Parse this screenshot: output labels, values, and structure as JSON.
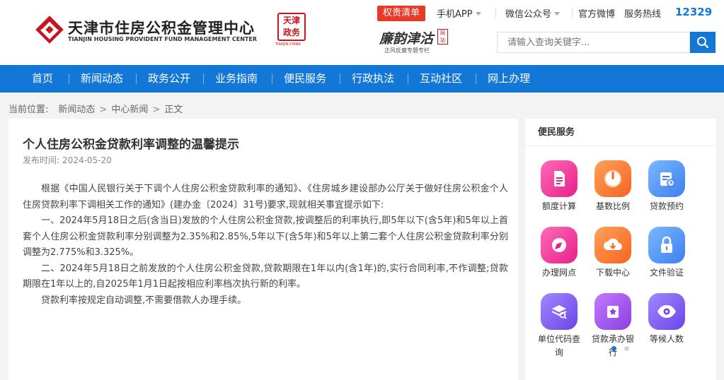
{
  "header": {
    "logo_icon": "housing-fund-logo-icon",
    "title_cn": "天津市住房公积金管理中心",
    "title_en": "TIANJIN HOUSING PROVIDENT FUND MANAGEMENT CENTER",
    "seal_text": [
      "天",
      "津",
      "政",
      "务"
    ],
    "seal_caption": "TIANJIN.CHINA",
    "power_list_badge": "权责清单",
    "brand_main": "廉韵津沽",
    "brand_tag": "网站",
    "brand_sub": "正风反腐专题专栏",
    "top_links": [
      {
        "label": "手机APP",
        "dropdown": true
      },
      {
        "label": "微信公众号",
        "dropdown": true
      },
      {
        "label": "官方微博",
        "dropdown": false
      },
      {
        "label": "服务热线",
        "dropdown": false
      }
    ],
    "hotline_number": "12329",
    "search_placeholder": "请输入查询关键字...",
    "search_icon": "search-icon",
    "accent_color": "#1377d8",
    "badge_color": "#e83828"
  },
  "nav": {
    "items": [
      "首页",
      "新闻动态",
      "政务公开",
      "业务指南",
      "便民服务",
      "行政执法",
      "互动社区",
      "网上办理"
    ]
  },
  "breadcrumb": {
    "label": "当前位置:",
    "items": [
      "新闻动态",
      "中心新闻",
      "正文"
    ],
    "separator": ">"
  },
  "article": {
    "title": "个人住房公积金贷款利率调整的温馨提示",
    "date_label": "发布时间:",
    "date": "2024-05-20",
    "paragraphs": [
      "根据《中国人民银行关于下调个人住房公积金贷款利率的通知》、《住房城乡建设部办公厅关于做好住房公积金个人住房贷款利率下调相关工作的通知》(建办金〔2024〕31号)要求,现就相关事宜提示如下:",
      "一、2024年5月18日之后(含当日)发放的个人住房公积金贷款,按调整后的利率执行,即5年以下(含5年)和5年以上首套个人住房公积金贷款利率分别调整为2.35%和2.85%,5年以下(含5年)和5年以上第二套个人住房公积金贷款利率分别调整为2.775%和3.325%。",
      "二、2024年5月18日之前发放的个人住房公积金贷款,贷款期限在1年以内(含1年)的,实行合同利率,不作调整;贷款期限在1年以上的,自2025年1月1日起按相应利率档次执行新的利率。",
      "贷款利率按规定自动调整,不需要借款人办理手续。"
    ]
  },
  "sidebar": {
    "title": "便民服务",
    "services": [
      {
        "label": "额度计算",
        "icon": "calculator-document-icon",
        "color_from": "#ff6ab8",
        "color_to": "#e8208a"
      },
      {
        "label": "基数比例",
        "icon": "ratio-gauge-icon",
        "color_from": "#ffa05a",
        "color_to": "#f56520"
      },
      {
        "label": "贷款预约",
        "icon": "calendar-clock-icon",
        "color_from": "#7ab8ff",
        "color_to": "#3d7ff0"
      },
      {
        "label": "办理网点",
        "icon": "location-compass-icon",
        "color_from": "#ff6ab8",
        "color_to": "#e8208a"
      },
      {
        "label": "下载中心",
        "icon": "cloud-download-icon",
        "color_from": "#ffa05a",
        "color_to": "#f56520"
      },
      {
        "label": "文件验证",
        "icon": "lock-verify-icon",
        "color_from": "#7ab8ff",
        "color_to": "#3d7ff0"
      },
      {
        "label": "单位代码查询",
        "icon": "layers-search-icon",
        "color_from": "#a287ff",
        "color_to": "#6a45e8"
      },
      {
        "label": "贷款承办银行",
        "icon": "bank-star-icon",
        "color_from": "#c27bff",
        "color_to": "#8c3ee0"
      },
      {
        "label": "等候人数",
        "icon": "eye-icon",
        "color_from": "#a287ff",
        "color_to": "#6a45e8"
      }
    ],
    "pager_dots": 2,
    "active_dot": 0
  }
}
